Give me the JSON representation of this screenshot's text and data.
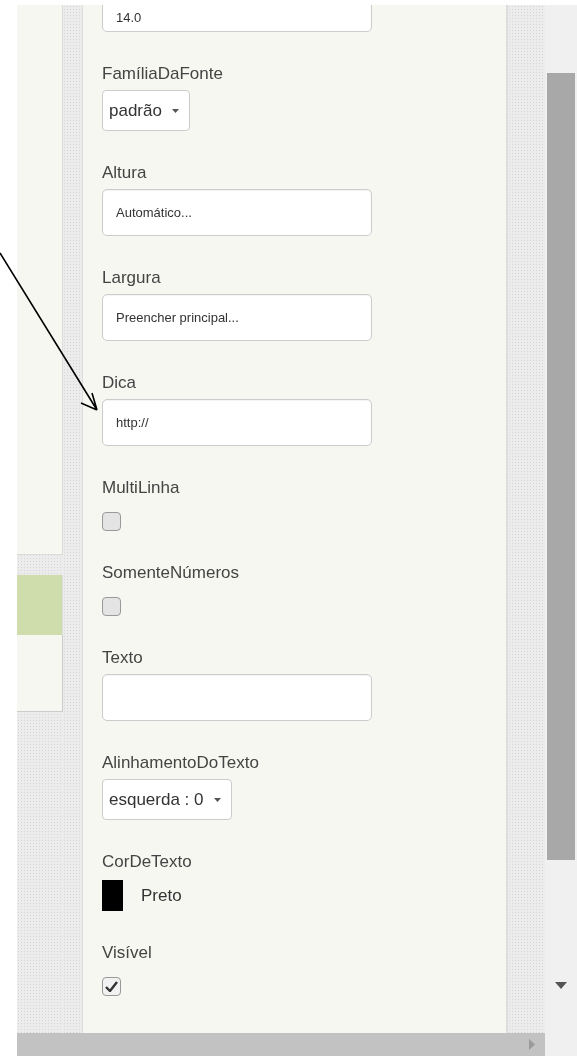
{
  "properties": [
    {
      "kind": "textbox",
      "value": "14.0"
    },
    {
      "kind": "dropdown",
      "label": "FamíliaDaFonte",
      "value": "padrão"
    },
    {
      "kind": "textbox",
      "label": "Altura",
      "value": "Automático..."
    },
    {
      "kind": "textbox",
      "label": "Largura",
      "value": "Preencher principal..."
    },
    {
      "kind": "textbox",
      "label": "Dica",
      "value": "http://"
    },
    {
      "kind": "checkbox",
      "label": "MultiLinha",
      "checked": false
    },
    {
      "kind": "checkbox",
      "label": "SomenteNúmeros",
      "checked": false
    },
    {
      "kind": "textbox",
      "label": "Texto"
    },
    {
      "kind": "dropdown",
      "label": "AlinhamentoDoTexto",
      "value": "esquerda : 0"
    },
    {
      "kind": "color",
      "label": "CorDeTexto",
      "value": "Preto",
      "color": "#000000"
    },
    {
      "kind": "checkbox",
      "label": "Visível",
      "checked": true
    }
  ]
}
